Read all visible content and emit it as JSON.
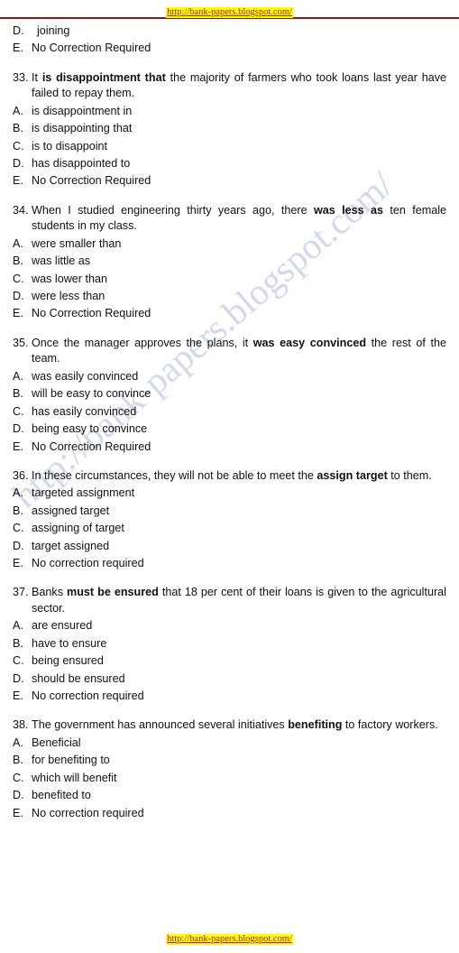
{
  "header": {
    "link": "http://bank-papers.blogspot.com/"
  },
  "watermark": {
    "text": "http://bank-papers.blogspot.com/"
  },
  "footer": {
    "link": "http://bank-papers.blogspot.com/"
  },
  "lead_options": [
    {
      "letter": "D.",
      "text": "joining"
    },
    {
      "letter": "E.",
      "text": "No Correction Required"
    }
  ],
  "questions": [
    {
      "number": "33.",
      "parts": [
        {
          "text": "It ",
          "bold": false
        },
        {
          "text": "is disappointment that",
          "bold": true
        },
        {
          "text": " the majority of farmers who took loans last year have failed to repay them.",
          "bold": false
        }
      ],
      "options": [
        {
          "letter": "A.",
          "text": "is disappointment in"
        },
        {
          "letter": "B.",
          "text": "is disappointing that"
        },
        {
          "letter": "C.",
          "text": "is to disappoint"
        },
        {
          "letter": "D.",
          "text": "has disappointed to"
        },
        {
          "letter": "E.",
          "text": "No Correction Required"
        }
      ]
    },
    {
      "number": "34.",
      "parts": [
        {
          "text": "When I studied engineering thirty years ago, there ",
          "bold": false
        },
        {
          "text": "was less as",
          "bold": true
        },
        {
          "text": " ten female students in my class.",
          "bold": false
        }
      ],
      "options": [
        {
          "letter": "A.",
          "text": "were smaller than"
        },
        {
          "letter": "B.",
          "text": "was little as"
        },
        {
          "letter": "C.",
          "text": "was lower than"
        },
        {
          "letter": "D.",
          "text": "were less than"
        },
        {
          "letter": "E.",
          "text": "No Correction Required"
        }
      ]
    },
    {
      "number": "35.",
      "parts": [
        {
          "text": "Once the manager approves the plans, it ",
          "bold": false
        },
        {
          "text": "was easy convinced",
          "bold": true
        },
        {
          "text": " the rest of the team.",
          "bold": false
        }
      ],
      "options": [
        {
          "letter": "A.",
          "text": "was easily convinced"
        },
        {
          "letter": "B.",
          "text": "will be easy to convince"
        },
        {
          "letter": "C.",
          "text": "has easily convinced"
        },
        {
          "letter": "D.",
          "text": "being easy to convince"
        },
        {
          "letter": "E.",
          "text": "No Correction Required"
        }
      ]
    },
    {
      "number": "36.",
      "parts": [
        {
          "text": "In these circumstances, they will not be able to meet the ",
          "bold": false
        },
        {
          "text": "assign target",
          "bold": true
        },
        {
          "text": " to them.",
          "bold": false
        }
      ],
      "options": [
        {
          "letter": "A.",
          "text": "targeted assignment"
        },
        {
          "letter": "B.",
          "text": "assigned target"
        },
        {
          "letter": "C.",
          "text": "assigning of target"
        },
        {
          "letter": "D.",
          "text": "target assigned"
        },
        {
          "letter": "E.",
          "text": "No correction required"
        }
      ]
    },
    {
      "number": "37.",
      "parts": [
        {
          "text": "Banks ",
          "bold": false
        },
        {
          "text": "must be ensured",
          "bold": true
        },
        {
          "text": " that 18 per cent of their loans is given to the agricultural sector.",
          "bold": false
        }
      ],
      "options": [
        {
          "letter": "A.",
          "text": "are ensured"
        },
        {
          "letter": "B.",
          "text": "have to ensure"
        },
        {
          "letter": "C.",
          "text": "being ensured"
        },
        {
          "letter": "D.",
          "text": "should be ensured"
        },
        {
          "letter": "E.",
          "text": "No correction required"
        }
      ]
    },
    {
      "number": "38.",
      "parts": [
        {
          "text": "The government has announced several initiatives ",
          "bold": false
        },
        {
          "text": "benefiting",
          "bold": true
        },
        {
          "text": " to factory workers.",
          "bold": false
        }
      ],
      "options": [
        {
          "letter": "A.",
          "text": "Beneficial"
        },
        {
          "letter": "B.",
          "text": "for benefiting to"
        },
        {
          "letter": "C.",
          "text": "which will benefit"
        },
        {
          "letter": "D.",
          "text": "benefited to"
        },
        {
          "letter": "E.",
          "text": "No correction required"
        }
      ]
    }
  ]
}
